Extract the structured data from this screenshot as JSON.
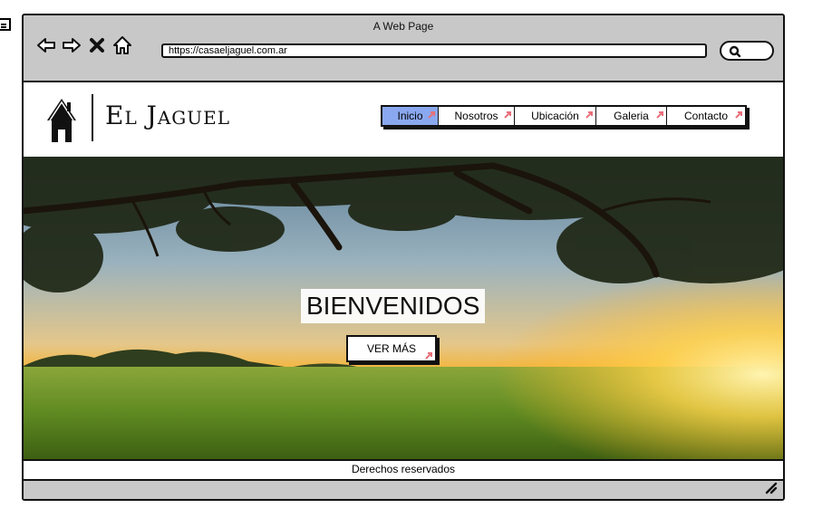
{
  "browser": {
    "window_title": "A Web Page",
    "url": "https://casaeljaguel.com.ar",
    "nav_icons": [
      "back-arrow-icon",
      "forward-arrow-icon",
      "close-icon",
      "home-icon"
    ],
    "search_icon": "search-icon"
  },
  "site": {
    "logo_text": "El Jaguel",
    "logo_icon": "house-icon",
    "menu": [
      {
        "label": "Inicio",
        "active": true
      },
      {
        "label": "Nosotros",
        "active": false
      },
      {
        "label": "Ubicación",
        "active": false
      },
      {
        "label": "Galeria",
        "active": false
      },
      {
        "label": "Contacto",
        "active": false
      }
    ],
    "menu_active_color": "#8aa8ef",
    "link_marker_color": "#e8707a"
  },
  "hero": {
    "title": "BIENVENIDOS",
    "button_label": "VER MÁS",
    "image": "landscape-tree-field-sunset"
  },
  "footer": {
    "text": "Derechos reservados"
  }
}
